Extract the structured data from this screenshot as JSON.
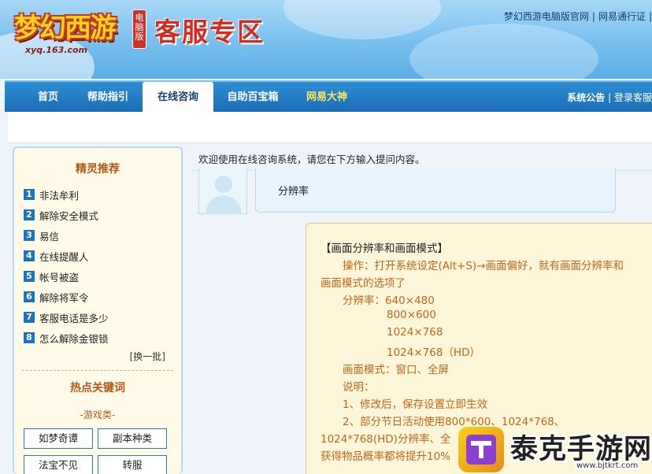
{
  "header": {
    "logo_text": "梦幻西游",
    "logo_sub": "xyq.163.com",
    "logo_badge": "电脑版",
    "title": "客服专区",
    "top_links": [
      "梦幻西游电脑版官网",
      "网易通行证"
    ]
  },
  "nav": {
    "items": [
      "首页",
      "帮助指引",
      "在线咨询",
      "自助百宝箱",
      "网易大神"
    ],
    "active_index": 2,
    "right_links": [
      "系统公告",
      "登录客服"
    ]
  },
  "sidebar": {
    "title": "精灵推荐",
    "items": [
      {
        "num": "1",
        "label": "非法牟利"
      },
      {
        "num": "2",
        "label": "解除安全模式"
      },
      {
        "num": "3",
        "label": "易信"
      },
      {
        "num": "4",
        "label": "在线提醒人"
      },
      {
        "num": "5",
        "label": "帐号被盗"
      },
      {
        "num": "6",
        "label": "解除将军令"
      },
      {
        "num": "7",
        "label": "客服电话是多少"
      },
      {
        "num": "8",
        "label": "怎么解除金银锁"
      }
    ],
    "refresh": "[换一批]",
    "hot_title": "热点关键词",
    "category": "-游戏类-",
    "keywords": [
      "如梦奇谭",
      "副本种类",
      "法宝不见",
      "转服"
    ]
  },
  "main": {
    "welcome": "欢迎使用在线咨询系统，请您在下方输入提问内容。",
    "question": "分辨率",
    "answer_lines": [
      "【画面分辨率和画面模式】",
      "操作：打开系统设定(Alt+S)→画面偏好，就有画面分辨率和",
      "画面模式的选项了",
      "分辨率：640×480",
      "800×600",
      "1024×768",
      "1024×768（HD）",
      "画面模式：窗口、全屏",
      "说明：",
      "1、修改后，保存设置立即生效",
      "2、部分节日活动使用800*600、1024*768、",
      "1024*768(HD)分辨率、全",
      "获得物品概率都将提升10%"
    ]
  },
  "watermark": {
    "text": "泰克手游网",
    "url": "www.bjtkrt.com"
  },
  "colors": {
    "nav_bg": "#1a6db7",
    "accent_orange": "#c0661a",
    "title_red": "#d92a1e",
    "badge_blue": "#1e74b8"
  }
}
